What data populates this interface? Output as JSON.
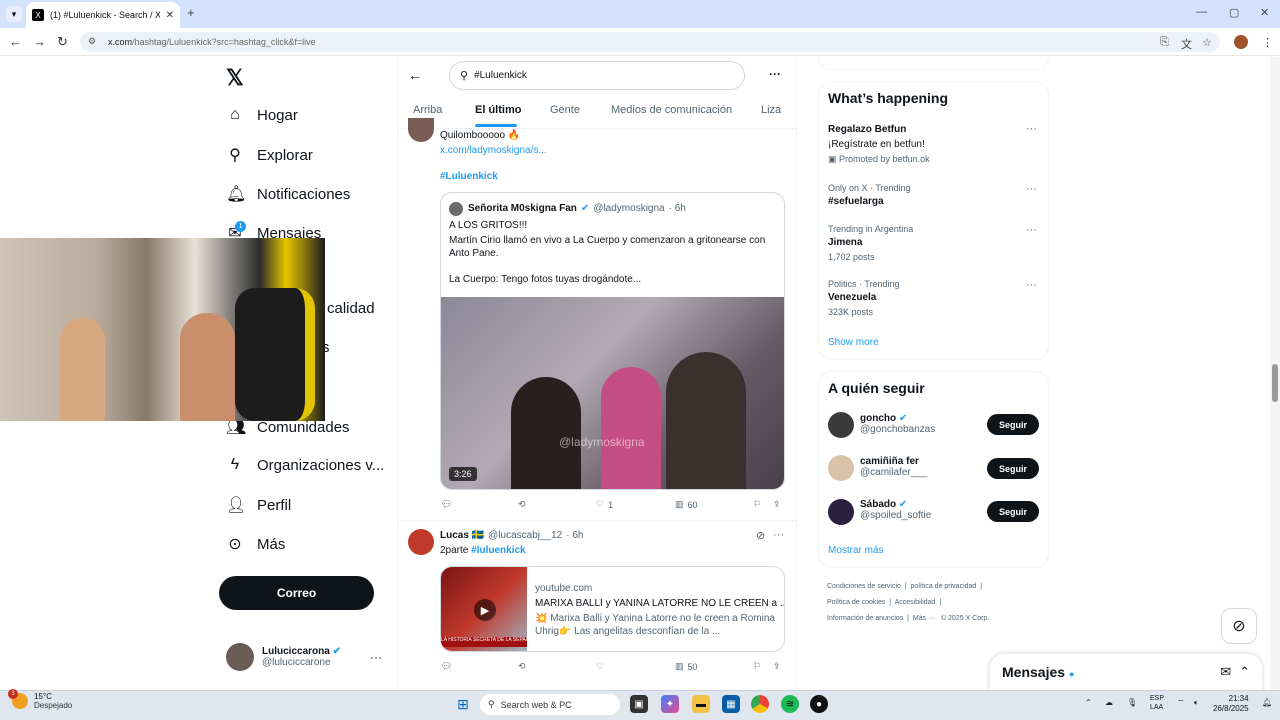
{
  "browser": {
    "tab_title": "(1) #Luluenkick - Search / X",
    "tab_favicon": "X",
    "url_host": "x.com",
    "url_path": "/hashtag/Luluenkick?src=hashtag_click&f=live"
  },
  "nav": {
    "items": [
      {
        "label": "Hogar",
        "icon": "home-icon"
      },
      {
        "label": "Explorar",
        "icon": "search-icon"
      },
      {
        "label": "Notificaciones",
        "icon": "bell-icon"
      },
      {
        "label": "Mensajes",
        "icon": "mail-icon",
        "badge": "1"
      },
      {
        "label": "calidad",
        "icon": "grok-icon"
      },
      {
        "label": "s",
        "icon": "bookmark-icon"
      },
      {
        "label": "Comunidades",
        "icon": "people-icon"
      },
      {
        "label": "Organizaciones v...",
        "icon": "lightning-icon"
      },
      {
        "label": "Perfil",
        "icon": "person-icon"
      },
      {
        "label": "Más",
        "icon": "more-circle-icon"
      }
    ],
    "post_button": "Correo",
    "account": {
      "name": "Luluciccarona",
      "handle": "@luluciccarone"
    }
  },
  "search": {
    "query": "#Luluenkick"
  },
  "tabs": [
    "Arriba",
    "El último",
    "Gente",
    "Medios de comunicación",
    "Liza"
  ],
  "active_tab": "El último",
  "tweet1": {
    "text": "Quilombooooo 🔥",
    "link": "x.com/ladymoskigna/s...",
    "hashtag": "#Luluenkick",
    "quote": {
      "name": "Señorita M0skigna Fan",
      "handle": "@ladymoskigna",
      "time": "· 6h",
      "line1": "A LOS GRITOS!!!",
      "line2": "Martín Cirio llamó en vivo a La Cuerpo y comenzaron a gritonearse con Anto Pane.",
      "line3": "La Cuerpo: Tengo fotos tuyas drogándote...",
      "video_duration": "3:26",
      "watermark": "@ladymoskigna"
    },
    "actions": {
      "replies": "",
      "reposts": "",
      "likes": "1",
      "views": "60"
    }
  },
  "tweet2": {
    "name": "Lucas 🇸🇪",
    "handle": "@lucascabj__12",
    "time": "· 6h",
    "text_prefix": "2parte",
    "hashtag": "#luluenkick",
    "card": {
      "domain": "youtube.com",
      "title": "MARIXA BALLI y YANINA LATORRE NO LE CREEN a ...",
      "desc": "💥 Marixa Balli y Yanina Latorre no le creen a Romina Uhrig👉 Las angelitas desconfían de la ...",
      "banner": "LA HISTORIA SECRETA DE LA SEPARACIÓN CON WALTER"
    },
    "actions": {
      "likes": "",
      "views": "50"
    }
  },
  "trending": {
    "title": "What’s happening",
    "items": [
      {
        "meta": "",
        "name": "Regalazo Betfun",
        "sub": "¡Regístrate en betfun!",
        "promo": "Promoted by betfun.ok"
      },
      {
        "meta": "Only on X · Trending",
        "name": "#sefuelarga",
        "sub": ""
      },
      {
        "meta": "Trending in Argentina",
        "name": "Jimena",
        "sub": "1,702 posts"
      },
      {
        "meta": "Politics · Trending",
        "name": "Venezuela",
        "sub": "323K posts"
      }
    ],
    "show_more": "Show more"
  },
  "follow": {
    "title": "A quién seguir",
    "items": [
      {
        "name": "goncho",
        "handle": "@gonchobanzas",
        "button": "Seguir"
      },
      {
        "name": "camiñiña fer",
        "handle": "@camilafer___",
        "button": "Seguir"
      },
      {
        "name": "Sábado",
        "handle": "@spoiled_softie",
        "button": "Seguir"
      }
    ],
    "more": "Mostrar más"
  },
  "footer": {
    "links": [
      "Condiciones de servicio",
      "política de privacidad",
      "Política de cookies",
      "Accesibilidad",
      "Información de anuncios",
      "Más ···",
      "© 2025 X Corp."
    ]
  },
  "dock": {
    "title": "Mensajes"
  },
  "taskbar": {
    "temp": "15°C",
    "weather": "Despejado",
    "weather_badge": "3",
    "search": "Search web & PC",
    "lang1": "ESP",
    "lang2": "LAA",
    "time": "21:34",
    "date": "26/8/2025"
  }
}
